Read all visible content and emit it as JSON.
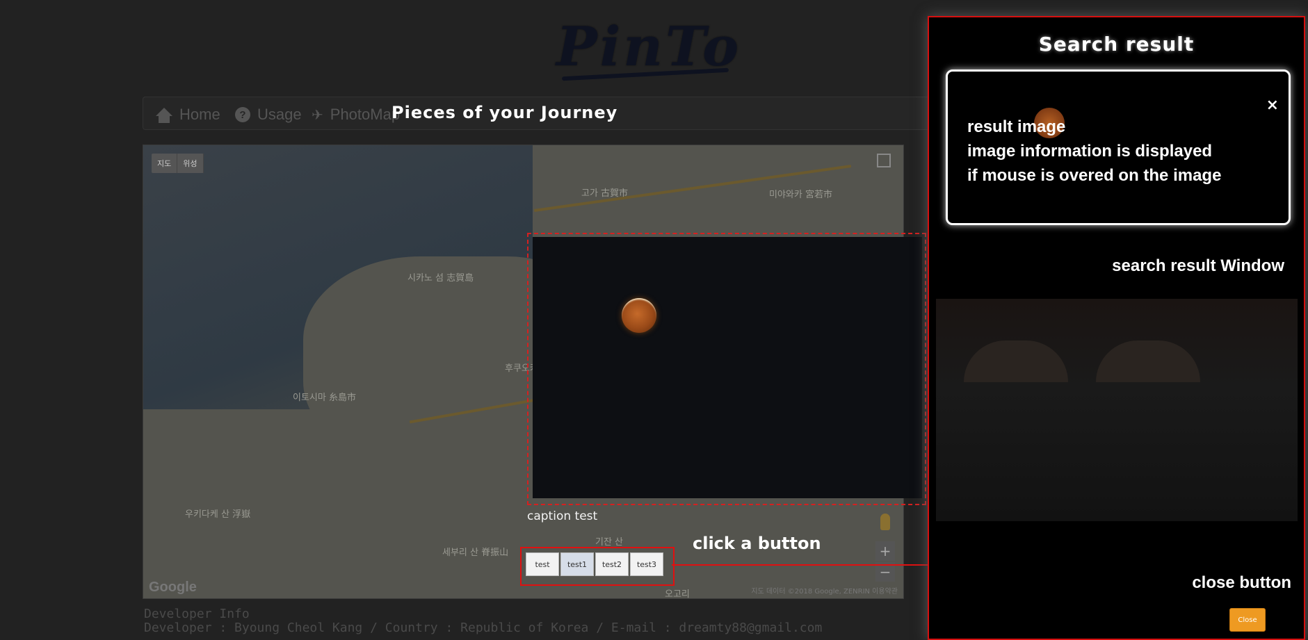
{
  "app": {
    "logo_text": "PinTo"
  },
  "nav": {
    "items": [
      {
        "label": "Home",
        "icon": "home-icon"
      },
      {
        "label": "Usage",
        "icon": "question-icon"
      },
      {
        "label": "PhotoMap",
        "icon": "plane-icon"
      }
    ]
  },
  "section": {
    "title": "Pieces of your Journey"
  },
  "map": {
    "type_buttons": [
      "지도",
      "위성"
    ],
    "labels": [
      "후쿠오카",
      "이토시마 糸島市",
      "시카노 섬 志賀島",
      "고가 古賀市",
      "미야와카 宮若市",
      "우키다케 산 浮嶽",
      "세부리 산 脊振山",
      "기잔 산",
      "오고리"
    ],
    "zoom_in": "+",
    "zoom_out": "−",
    "google_logo": "Google",
    "copyright": "지도 데이터 ©2018 Google, ZENRIN   이용약관"
  },
  "viewer": {
    "caption": "caption test",
    "buttons": [
      "test",
      "test1",
      "test2",
      "test3"
    ],
    "active_button_index": 1,
    "annotation": "click a button"
  },
  "developer": {
    "line1": "Developer Info",
    "line2": "Developer : Byoung Cheol Kang / Country : Republic of Korea / E-mail : dreamty88@gmail.com"
  },
  "panel": {
    "title": "Search result",
    "result_text_lines": [
      "result image",
      "image information is displayed",
      "if mouse is overed on the image"
    ],
    "close_x": "×",
    "window_annotation": "search result Window",
    "close_annotation": "close button",
    "close_button_label": "Close"
  },
  "colors": {
    "annotation_red": "#e01010",
    "close_button": "#ee9a22"
  }
}
